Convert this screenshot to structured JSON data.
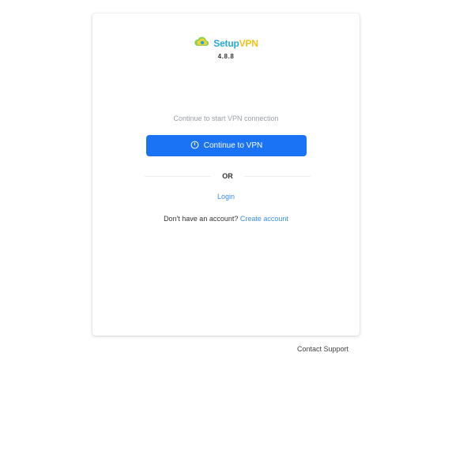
{
  "brand": {
    "logo_part1": "Setup",
    "logo_part2": "VPN",
    "version": "4.8.8",
    "colors": {
      "setup": "#2aa6d9",
      "vpn": "#f2c314",
      "primary": "#1a73f5",
      "link": "#3a8ee6"
    },
    "logo_icon": "cloud-logo-icon"
  },
  "main": {
    "hint": "Continue to start VPN connection",
    "continue_button": {
      "label": "Continue to VPN",
      "icon": "power-icon"
    },
    "divider_text": "OR",
    "login_link": "Login",
    "signup_prompt": "Don't have an account?",
    "create_account_link": "Create account"
  },
  "footer": {
    "support_link": "Contact Support"
  }
}
